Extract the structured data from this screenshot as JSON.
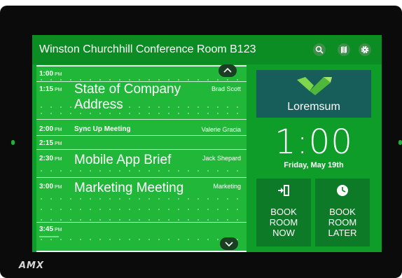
{
  "device": {
    "brand": "AMX"
  },
  "header": {
    "room_title": "Winston Churchhill Conference Room B123",
    "icons": [
      "search-icon",
      "map-icon",
      "gear-icon"
    ]
  },
  "schedule": {
    "slots": [
      {
        "time": "1:00",
        "ampm": "PM"
      },
      {
        "time": "1:15",
        "ampm": "PM",
        "event": "State of Company Address",
        "line1": "State of Company",
        "line2": "Address",
        "organizer": "Brad Scott"
      },
      {
        "time": "2:00",
        "ampm": "PM",
        "event": "Sync Up Meeting",
        "organizer": "Valerie Gracia"
      },
      {
        "time": "2:15",
        "ampm": "PM"
      },
      {
        "time": "2:30",
        "ampm": "PM",
        "event": "Mobile App Brief",
        "organizer": "Jack Shepard"
      },
      {
        "time": "3:00",
        "ampm": "PM",
        "event": "Marketing Meeting",
        "organizer": "Marketing"
      },
      {
        "time": "3:45",
        "ampm": "PM"
      }
    ]
  },
  "sidebar": {
    "logo_text": "Loremsum",
    "clock": "1:00",
    "date": "Friday, May 19th",
    "book_now": {
      "line1": "BOOK",
      "line2": "ROOM",
      "line3": "NOW",
      "icon": "door-enter-icon"
    },
    "book_later": {
      "line1": "BOOK",
      "line2": "ROOM",
      "line3": "LATER",
      "icon": "clock-icon"
    }
  },
  "colors": {
    "screen_bg": "#0f9d2a",
    "header_bg": "#0b8d23",
    "schedule_bg": "#21b83a",
    "logo_bg": "#175e5b",
    "button_bg": "#0d7a27",
    "bezel": "#0b0b0b"
  }
}
